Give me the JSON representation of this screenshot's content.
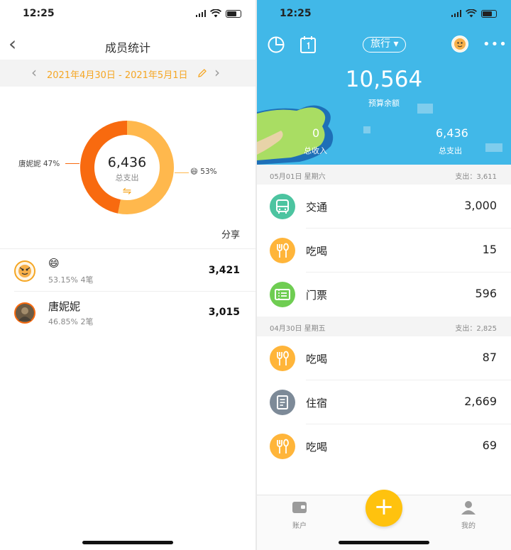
{
  "status": {
    "time": "12:25"
  },
  "left": {
    "nav_title": "成员统计",
    "date_range": "2021年4月30日 - 2021年5月1日",
    "total": "6,436",
    "total_label": "总支出",
    "switch_glyph": "⇋",
    "share_label": "分享",
    "chart_data": {
      "type": "pie",
      "title": "",
      "slices": [
        {
          "label": "😄 53%",
          "percent": 53.15,
          "color": "#ffb84d"
        },
        {
          "label": "唐妮妮 47%",
          "percent": 46.85,
          "color": "#f86a0f"
        }
      ]
    },
    "members": [
      {
        "name": "😄",
        "meta": "53.15%  4笔",
        "amount": "3,421",
        "avatar_icon": "tiger-avatar-icon"
      },
      {
        "name": "唐妮妮",
        "meta": "46.85%  2笔",
        "amount": "3,015",
        "avatar_icon": "photo-avatar-icon"
      }
    ]
  },
  "right": {
    "book_name": "旅行 ▾",
    "balance": "10,564",
    "balance_label": "预算余额",
    "income": "0",
    "income_label": "总收入",
    "expense": "6,436",
    "expense_label": "总支出",
    "days": [
      {
        "date": "05月01日 星期六",
        "summary": "支出：3,611",
        "items": [
          {
            "name": "交通",
            "amount": "3,000",
            "icon": "bus-icon",
            "color": "#4cc4a0"
          },
          {
            "name": "吃喝",
            "amount": "15",
            "icon": "fork-spoon-icon",
            "color": "#ffb53a"
          },
          {
            "name": "门票",
            "amount": "596",
            "icon": "ticket-icon",
            "color": "#6fcd52"
          }
        ]
      },
      {
        "date": "04月30日 星期五",
        "summary": "支出：2,825",
        "items": [
          {
            "name": "吃喝",
            "amount": "87",
            "icon": "fork-spoon-icon",
            "color": "#ffb53a"
          },
          {
            "name": "住宿",
            "amount": "2,669",
            "icon": "hotel-icon",
            "color": "#7d8a98"
          },
          {
            "name": "吃喝",
            "amount": "69",
            "icon": "fork-spoon-icon",
            "color": "#ffb53a"
          }
        ]
      }
    ],
    "tabs": {
      "account": "账户",
      "mine": "我的"
    },
    "fab": "+"
  }
}
